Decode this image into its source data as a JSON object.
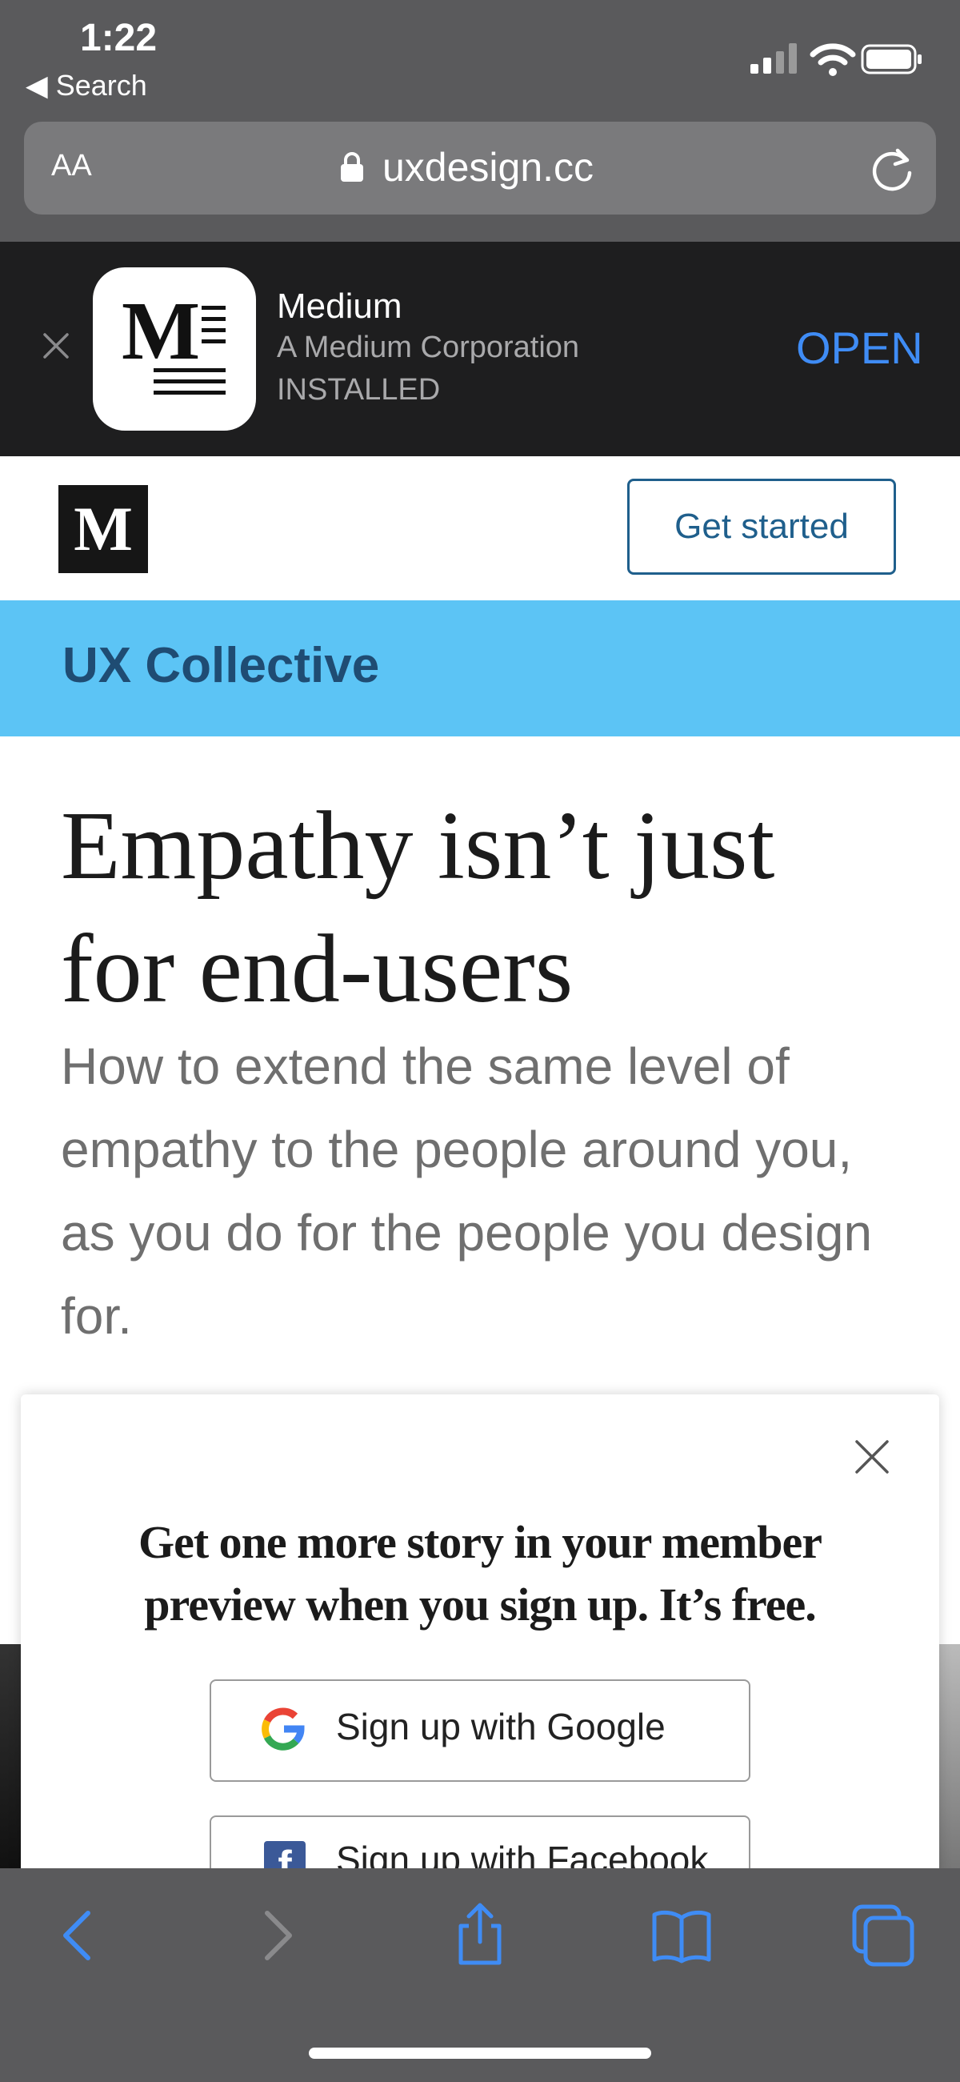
{
  "status_bar": {
    "time": "1:22",
    "back_app": "Search"
  },
  "browser": {
    "text_size_label": "AA",
    "url": "uxdesign.cc"
  },
  "app_banner": {
    "app_name": "Medium",
    "publisher": "A Medium Corporation",
    "status": "INSTALLED",
    "action_label": "OPEN",
    "icon_letter": "M"
  },
  "site_header": {
    "logo_letter": "M",
    "get_started_label": "Get started"
  },
  "publication": {
    "name": "UX Collective"
  },
  "article": {
    "title": "Empathy isn’t just for end-users",
    "subtitle": "How to extend the same level of empathy to the people around you, as you do for the people you design for."
  },
  "signup_modal": {
    "heading": "Get one more story in your member preview when you sign up. It’s free.",
    "google_label": "Sign up with Google",
    "facebook_label": "Sign up with Facebook",
    "facebook_icon_letter": "f"
  },
  "colors": {
    "publication_bar": "#5cc4f5",
    "publication_text": "#1f4c73",
    "ios_accent": "#3f8cf5",
    "get_started_border": "#1f5f8c"
  },
  "toolbar": {
    "icons": [
      "back-icon",
      "forward-icon",
      "share-icon",
      "bookmarks-icon",
      "tabs-icon"
    ]
  }
}
